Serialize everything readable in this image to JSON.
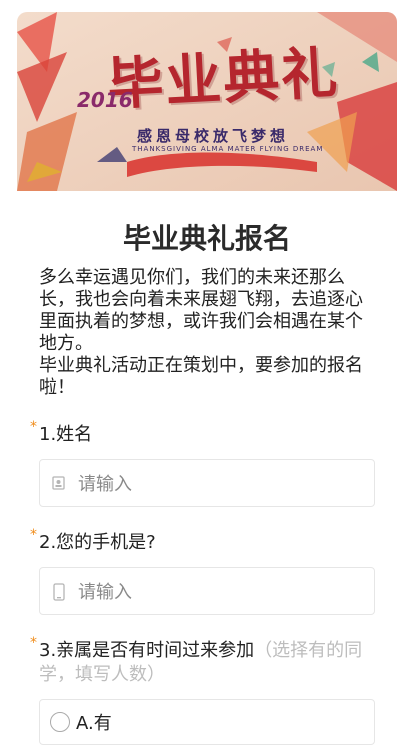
{
  "banner": {
    "title": "毕业典礼",
    "year": "2016",
    "subtitle": "感恩母校放飞梦想",
    "subtitle_en": "THANKSGIVING ALMA MATER FLYING DREAM"
  },
  "form": {
    "title": "毕业典礼报名",
    "description": [
      "多么幸运遇见你们，我们的未来还那么长，我也会向着未来展翅飞翔，去追逐心里面执着的梦想，或许我们会相遇在某个地方。",
      "毕业典礼活动正在策划中，要参加的报名啦！"
    ],
    "questions": [
      {
        "required_mark": "*",
        "label": "1.姓名",
        "hint": "",
        "placeholder": "请输入",
        "icon": "person-card-icon"
      },
      {
        "required_mark": "*",
        "label": "2.您的手机是?",
        "hint": "",
        "placeholder": "请输入",
        "icon": "phone-icon"
      },
      {
        "required_mark": "*",
        "label": "3.亲属是否有时间过来参加",
        "hint": "（选择有的同学，填写人数）",
        "options": [
          "A.有"
        ]
      }
    ]
  },
  "colors": {
    "required": "#f08c1a",
    "title_red": "#b5262e",
    "placeholder": "#8a8a8a",
    "hint": "#bdbdbd"
  }
}
